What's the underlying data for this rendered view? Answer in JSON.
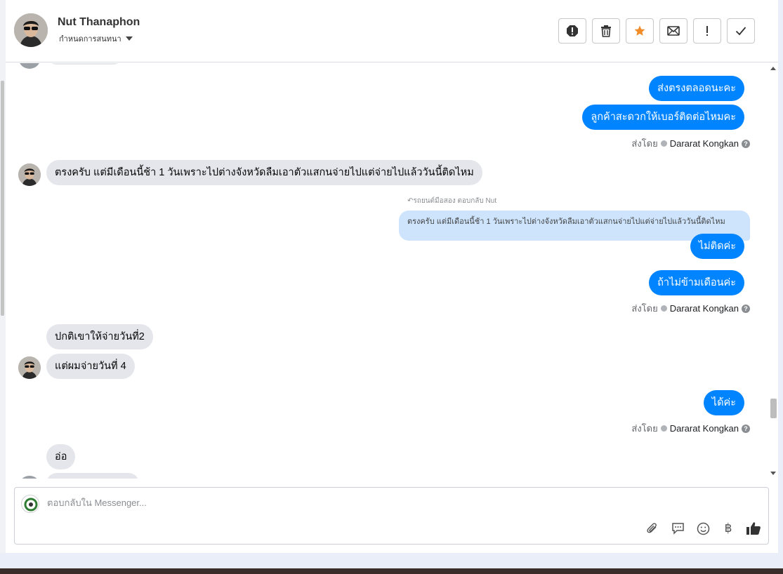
{
  "header": {
    "name": "Nut Thanaphon",
    "assign_label": "กำหนดการสนทนา",
    "actions": [
      {
        "name": "spam-icon"
      },
      {
        "name": "trash-icon"
      },
      {
        "name": "star-icon",
        "color": "#f28c28"
      },
      {
        "name": "mail-icon"
      },
      {
        "name": "exclamation-icon"
      },
      {
        "name": "check-icon"
      }
    ]
  },
  "messages": {
    "out1": "ส่งตรงตลอดนะคะ",
    "out2": "ลูกค้าสะดวกให้เบอร์ติดต่อไหมคะ",
    "in1": "ตรงครับ แต่มีเดือนนี้ช้า 1 วันเพราะไปต่างจังหวัดลืมเอาตัวแสกนจ่ายไปแต่จ่ายไปแล้ววันนี้ติดไหม",
    "reply_header": "รถยนต์มือสอง ตอบกลับ Nut",
    "quoted": "ตรงครับ แต่มีเดือนนี้ช้า 1 วันเพราะไปต่างจังหวัดลืมเอาตัวแสกนจ่ายไปแต่จ่ายไปแล้ววันนี้ติดไหม",
    "out3": "ไม่ติดค่ะ",
    "out4": "ถ้าไม่ข้ามเดือนค่ะ",
    "in2": "ปกติเขาให้จ่ายวันที่2",
    "in3": "แต่ผมจ่ายวันที่ 4",
    "out5": "ได้ค่ะ",
    "in4": "อ่อ"
  },
  "sent_by": {
    "label": "ส่งโดย",
    "agent": "Dararat Kongkan"
  },
  "composer": {
    "placeholder": "ตอบกลับใน Messenger...",
    "tools": [
      "paperclip-icon",
      "comment-icon",
      "smile-icon",
      "baht-icon",
      "thumbs-up-icon"
    ],
    "baht_glyph": "฿"
  },
  "colors": {
    "outgoing": "#0084ff",
    "incoming": "#e4e6eb",
    "quote": "#cde4fc"
  }
}
